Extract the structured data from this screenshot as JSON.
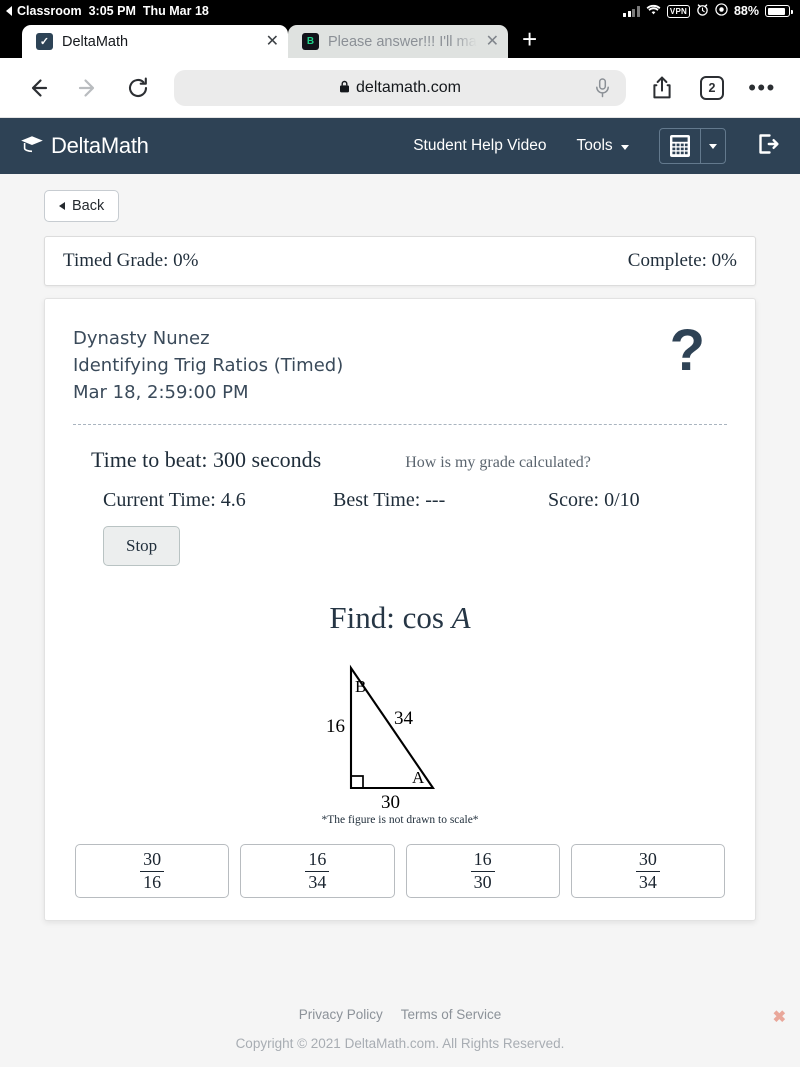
{
  "status_bar": {
    "back_app": "Classroom",
    "time": "3:05 PM",
    "date": "Thu Mar 18",
    "vpn_label": "VPN",
    "battery_percent": "88%"
  },
  "tabs": [
    {
      "title": "DeltaMath",
      "favicon_letter": "✓",
      "close_label": "✕",
      "active": true
    },
    {
      "title": "Please answer!!! I'll make",
      "favicon_letter": "B",
      "close_label": "✕",
      "active": false
    }
  ],
  "tab_new_label": "+",
  "browser": {
    "url": "deltamath.com",
    "lock_icon": "🔒",
    "tab_count": "2",
    "more_label": "•••"
  },
  "navbar": {
    "brand": "DeltaMath",
    "help_video": "Student Help Video",
    "tools": "Tools",
    "accent": "#2e4255"
  },
  "toolbar": {
    "back_label": "Back"
  },
  "grade_bar": {
    "timed_grade": "Timed Grade: 0%",
    "complete": "Complete: 0%"
  },
  "assignment": {
    "student": "Dynasty Nunez",
    "title": "Identifying Trig Ratios (Timed)",
    "timestamp": "Mar 18, 2:59:00 PM",
    "help_icon_label": "?"
  },
  "stats": {
    "time_to_beat": "Time to beat: 300 seconds",
    "how_graded": "How is my grade calculated?",
    "current_time": "Current Time: 4.6",
    "best_time": "Best Time: ---",
    "score": "Score: 0/10",
    "stop_label": "Stop"
  },
  "problem": {
    "prompt_prefix": "Find:  cos",
    "prompt_variable": "A",
    "note": "*The figure is not drawn to scale*",
    "figure": {
      "vertex_top": "B",
      "vertex_bottom_right": "A",
      "side_left": "16",
      "side_hypotenuse": "34",
      "side_bottom": "30"
    },
    "choices": [
      {
        "numerator": "30",
        "denominator": "16"
      },
      {
        "numerator": "16",
        "denominator": "34"
      },
      {
        "numerator": "16",
        "denominator": "30"
      },
      {
        "numerator": "30",
        "denominator": "34"
      }
    ]
  },
  "footer": {
    "privacy": "Privacy Policy",
    "terms": "Terms of Service",
    "copyright": "Copyright © 2021 DeltaMath.com. All Rights Reserved.",
    "close_label": "✖"
  }
}
